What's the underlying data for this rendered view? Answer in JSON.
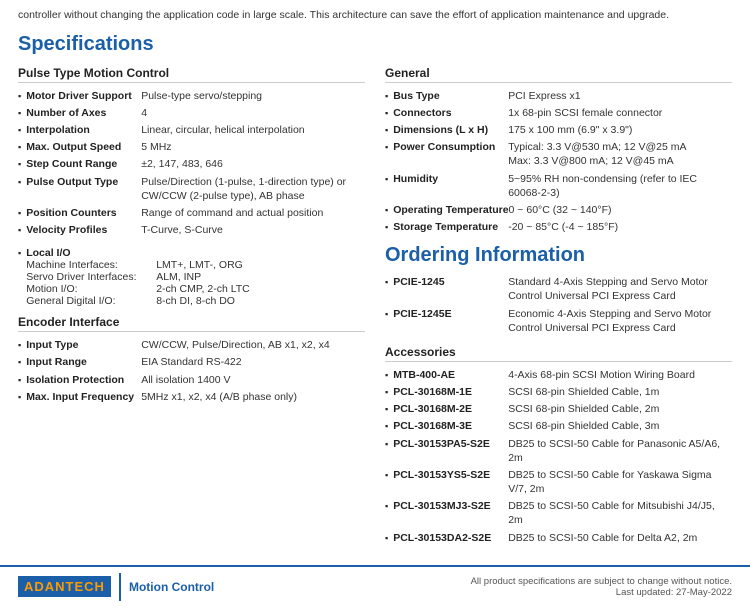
{
  "intro": {
    "text": "controller without changing the application code in large scale. This architecture can save the effort of application maintenance and upgrade."
  },
  "specs_title": "Specifications",
  "pulse_section": {
    "title": "Pulse Type Motion Control",
    "items": [
      {
        "label": "Motor Driver Support",
        "value": "Pulse-type servo/stepping"
      },
      {
        "label": "Number of Axes",
        "value": "4"
      },
      {
        "label": "Interpolation",
        "value": "Linear, circular, helical interpolation"
      },
      {
        "label": "Max. Output Speed",
        "value": "5 MHz"
      },
      {
        "label": "Step Count Range",
        "value": "±2, 147, 483, 646"
      },
      {
        "label": "Pulse Output Type",
        "value": "Pulse/Direction (1-pulse, 1-direction type) or CW/CCW (2-pulse type), AB phase"
      },
      {
        "label": "Position Counters",
        "value": "Range of command and actual position"
      },
      {
        "label": "Velocity Profiles",
        "value": "T-Curve, S-Curve"
      }
    ],
    "local_io": {
      "label": "Local I/O",
      "rows": [
        {
          "key": "Machine Interfaces:",
          "value": "LMT+, LMT-, ORG"
        },
        {
          "key": "Servo Driver Interfaces:",
          "value": "ALM, INP"
        },
        {
          "key": "Motion I/O:",
          "value": "2-ch CMP, 2-ch LTC"
        },
        {
          "key": "General Digital I/O:",
          "value": "8-ch DI, 8-ch DO"
        }
      ]
    }
  },
  "encoder_section": {
    "title": "Encoder Interface",
    "items": [
      {
        "label": "Input Type",
        "value": "CW/CCW, Pulse/Direction, AB x1, x2, x4"
      },
      {
        "label": "Input Range",
        "value": "EIA Standard RS-422"
      },
      {
        "label": "Isolation Protection",
        "value": "All isolation 1400 V"
      },
      {
        "label": "Max. Input Frequency",
        "value": "5MHz x1, x2, x4 (A/B phase only)"
      }
    ]
  },
  "general_section": {
    "title": "General",
    "items": [
      {
        "label": "Bus Type",
        "value": "PCI Express x1"
      },
      {
        "label": "Connectors",
        "value": "1x 68-pin SCSI female connector"
      },
      {
        "label": "Dimensions (L x H)",
        "value": "175 x 100 mm (6.9\" x 3.9\")"
      },
      {
        "label": "Power Consumption",
        "value": "Typical: 3.3 V@530 mA; 12 V@25 mA\nMax: 3.3 V@800 mA; 12 V@45 mA"
      },
      {
        "label": "Humidity",
        "value": "5~95% RH non-condensing (refer to IEC 60068-2-3)"
      },
      {
        "label": "Operating Temperature",
        "value": "0 ~ 60°C (32 ~ 140°F)"
      },
      {
        "label": "Storage Temperature",
        "value": "-20 ~ 85°C (-4 ~ 185°F)"
      }
    ]
  },
  "ordering_title": "Ordering Information",
  "ordering_items": [
    {
      "label": "PCIE-1245",
      "value": "Standard 4-Axis Stepping and Servo Motor Control Universal PCI Express Card"
    },
    {
      "label": "PCIE-1245E",
      "value": "Economic 4-Axis Stepping and Servo Motor Control Universal PCI Express Card"
    }
  ],
  "accessories_section": {
    "title": "Accessories",
    "items": [
      {
        "label": "MTB-400-AE",
        "value": "4-Axis 68-pin SCSI Motion Wiring Board"
      },
      {
        "label": "PCL-30168M-1E",
        "value": "SCSI 68-pin Shielded Cable, 1m"
      },
      {
        "label": "PCL-30168M-2E",
        "value": "SCSI 68-pin Shielded Cable, 2m"
      },
      {
        "label": "PCL-30168M-3E",
        "value": "SCSI 68-pin Shielded Cable, 3m"
      },
      {
        "label": "PCL-30153PA5-S2E",
        "value": "DB25 to SCSI-50 Cable for Panasonic A5/A6, 2m"
      },
      {
        "label": "PCL-30153YS5-S2E",
        "value": "DB25 to SCSI-50 Cable for Yaskawa Sigma V/7, 2m"
      },
      {
        "label": "PCL-30153MJ3-S2E",
        "value": "DB25 to SCSI-50 Cable for Mitsubishi J4/J5, 2m"
      },
      {
        "label": "PCL-30153DA2-S2E",
        "value": "DB25 to SCSI-50 Cable for Delta A2, 2m"
      }
    ]
  },
  "footer": {
    "logo_text": "AD",
    "logo_highlight": "ANTECH",
    "tagline": "Motion Control",
    "notice": "All product specifications are subject to change without notice.",
    "date": "Last updated: 27-May-2022"
  }
}
